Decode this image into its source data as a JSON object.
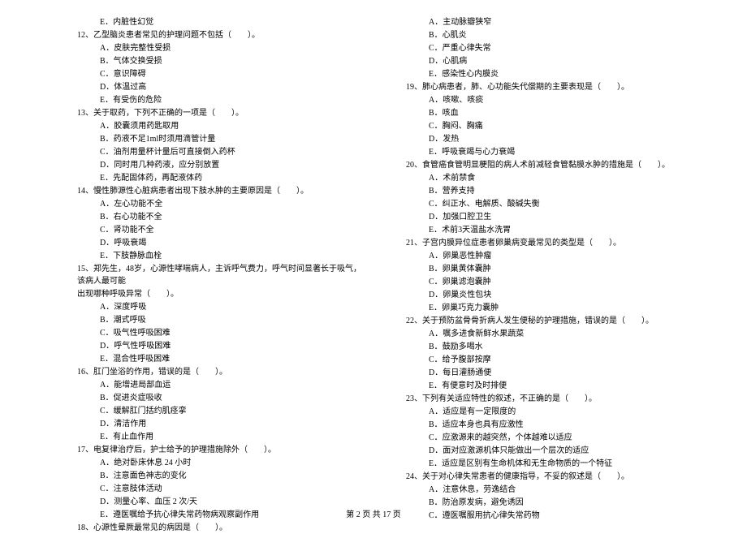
{
  "left_column": {
    "items": [
      {
        "type": "option",
        "text": "E．内脏性幻觉"
      },
      {
        "type": "question",
        "text": "12、乙型脑炎患者常见的护理问题不包括（　　）。"
      },
      {
        "type": "option",
        "text": "A．皮肤完整性受损"
      },
      {
        "type": "option",
        "text": "B．气体交换受损"
      },
      {
        "type": "option",
        "text": "C．意识障碍"
      },
      {
        "type": "option",
        "text": "D．体温过高"
      },
      {
        "type": "option",
        "text": "E．有受伤的危险"
      },
      {
        "type": "question",
        "text": "13、关于取药，下列不正确的一项是（　　）。"
      },
      {
        "type": "option",
        "text": "A．胶囊须用药匙取用"
      },
      {
        "type": "option",
        "text": "B．药液不足1ml时须用滴管计量"
      },
      {
        "type": "option",
        "text": "C．油剂用量杯计量后可直接倒入药杯"
      },
      {
        "type": "option",
        "text": "D．同时用几种药液，应分别放置"
      },
      {
        "type": "option",
        "text": "E．先配固体药，再配液体药"
      },
      {
        "type": "question",
        "text": "14、慢性肺源性心脏病患者出现下肢水肿的主要原因是（　　）。"
      },
      {
        "type": "option",
        "text": "A．左心功能不全"
      },
      {
        "type": "option",
        "text": "B．右心功能不全"
      },
      {
        "type": "option",
        "text": "C．肾功能不全"
      },
      {
        "type": "option",
        "text": "D．呼吸衰竭"
      },
      {
        "type": "option",
        "text": "E．下肢静脉血栓"
      },
      {
        "type": "question",
        "text": "15、郑先生，48岁，心源性哮喘病人，主诉呼气费力，呼气时间显著长于吸气，该病人最可能"
      },
      {
        "type": "continuation",
        "text": "出现哪种呼吸异常（　　）。"
      },
      {
        "type": "option",
        "text": "A．深度呼吸"
      },
      {
        "type": "option",
        "text": "B．潮式呼吸"
      },
      {
        "type": "option",
        "text": "C．吸气性呼吸困难"
      },
      {
        "type": "option",
        "text": "D．呼气性呼吸困难"
      },
      {
        "type": "option",
        "text": "E．混合性呼吸困难"
      },
      {
        "type": "question",
        "text": "16、肛门坐浴的作用，错误的是（　　）。"
      },
      {
        "type": "option",
        "text": "A．能增进局部血运"
      },
      {
        "type": "option",
        "text": "B．促进炎症吸收"
      },
      {
        "type": "option",
        "text": "C．缓解肛门括约肌痉挛"
      },
      {
        "type": "option",
        "text": "D．清洁作用"
      },
      {
        "type": "option",
        "text": "E．有止血作用"
      },
      {
        "type": "question",
        "text": "17、电复律治疗后，护士给予的护理措施除外（　　）。"
      },
      {
        "type": "option",
        "text": "A．绝对卧床休息 24 小时"
      },
      {
        "type": "option",
        "text": "B．注意面色神志的变化"
      },
      {
        "type": "option",
        "text": "C．注意肢体活动"
      },
      {
        "type": "option",
        "text": "D．测量心率、血压 2 次/天"
      },
      {
        "type": "option",
        "text": "E．遵医嘱给予抗心律失常药物病观察副作用"
      },
      {
        "type": "question",
        "text": "18、心源性晕厥最常见的病因是（　　）。"
      }
    ]
  },
  "right_column": {
    "items": [
      {
        "type": "option",
        "text": "A．主动脉瓣狭窄"
      },
      {
        "type": "option",
        "text": "B．心肌炎"
      },
      {
        "type": "option",
        "text": "C．严重心律失常"
      },
      {
        "type": "option",
        "text": "D．心肌病"
      },
      {
        "type": "option",
        "text": "E．感染性心内膜炎"
      },
      {
        "type": "question",
        "text": "19、肺心病患者，肺、心功能失代偿期的主要表现是（　　）。"
      },
      {
        "type": "option",
        "text": "A．咳嗽、咳痰"
      },
      {
        "type": "option",
        "text": "B．咳血"
      },
      {
        "type": "option",
        "text": "C．胸闷、胸痛"
      },
      {
        "type": "option",
        "text": "D．发热"
      },
      {
        "type": "option",
        "text": "E．呼吸衰竭与心力衰竭"
      },
      {
        "type": "question",
        "text": "20、食管癌食管明显梗阻的病人术前减轻食管黏膜水肿的措施是（　　）。"
      },
      {
        "type": "option",
        "text": "A．术前禁食"
      },
      {
        "type": "option",
        "text": "B．营养支持"
      },
      {
        "type": "option",
        "text": "C．纠正水、电解质、酸碱失衡"
      },
      {
        "type": "option",
        "text": "D．加强口腔卫生"
      },
      {
        "type": "option",
        "text": "E．术前3天温盐水洗胃"
      },
      {
        "type": "question",
        "text": "21、子宫内膜异位症患者卵巢病变最常见的类型是（　　）。"
      },
      {
        "type": "option",
        "text": "A．卵巢恶性肿瘤"
      },
      {
        "type": "option",
        "text": "B．卵巢黄体囊肿"
      },
      {
        "type": "option",
        "text": "C．卵巢滤泡囊肿"
      },
      {
        "type": "option",
        "text": "D．卵巢炎性包块"
      },
      {
        "type": "option",
        "text": "E．卵巢巧克力囊肿"
      },
      {
        "type": "question",
        "text": "22、关于预防盆骨骨折病人发生便秘的护理措施，错误的是（　　）。"
      },
      {
        "type": "option",
        "text": "A．嘱多进食新鲜水果蔬菜"
      },
      {
        "type": "option",
        "text": "B．鼓励多喝水"
      },
      {
        "type": "option",
        "text": "C．给予腹部按摩"
      },
      {
        "type": "option",
        "text": "D．每日灌肠通便"
      },
      {
        "type": "option",
        "text": "E．有便意时及时排便"
      },
      {
        "type": "question",
        "text": "23、下列有关适应特性的叙述，不正确的是（　　）。"
      },
      {
        "type": "option",
        "text": "A．适应是有一定限度的"
      },
      {
        "type": "option",
        "text": "B．适应本身也具有应激性"
      },
      {
        "type": "option",
        "text": "C．应激源来的越突然，个体越难以适应"
      },
      {
        "type": "option",
        "text": "D．面对应激源机体只能做出一个层次的适应"
      },
      {
        "type": "option",
        "text": "E．适应是区别有生命机体和无生命物质的一个特征"
      },
      {
        "type": "question",
        "text": "24、关于对心律失常患者的健康指导，不妥的叙述是（　　）。"
      },
      {
        "type": "option",
        "text": "A．注意休息，劳逸结合"
      },
      {
        "type": "option",
        "text": "B．防治原发病，避免诱因"
      },
      {
        "type": "option",
        "text": "C．遵医嘱服用抗心律失常药物"
      }
    ]
  },
  "footer": {
    "text": "第 2 页 共 17 页"
  }
}
